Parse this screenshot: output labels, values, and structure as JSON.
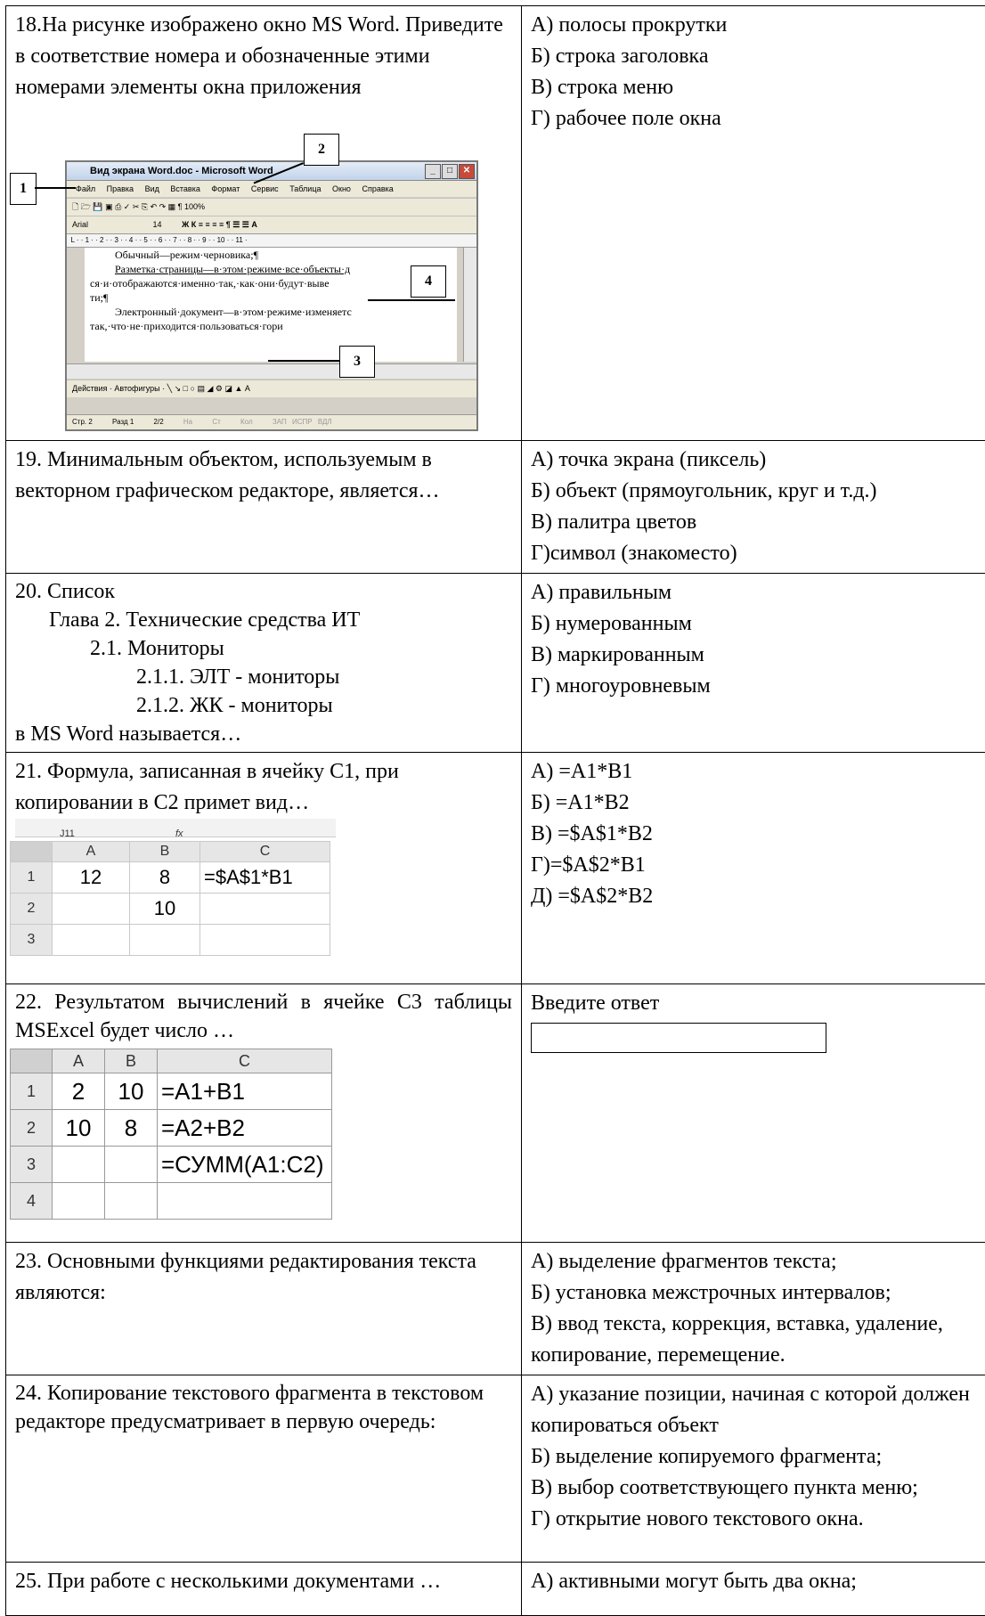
{
  "questions": [
    {
      "q": "18.На рисунке изображено окно  MS Word. Приведите в соответствие номера и обозначенные этими номерами элементы окна приложения",
      "options": [
        "А) полосы прокрутки",
        "Б) строка заголовка",
        "В) строка меню",
        "Г) рабочее поле окна"
      ],
      "figure": {
        "title": "Вид экрана Word.doc - Microsoft Word",
        "menu": [
          "Файл",
          "Правка",
          "Вид",
          "Вставка",
          "Формат",
          "Сервис",
          "Таблица",
          "Окно",
          "Справка"
        ],
        "toolbar1": "100%",
        "toolbar2_font": "Arial",
        "toolbar2_size": "14",
        "doc_lines": [
          "Обычный—режим·черновика;¶",
          "Разметка·страницы—в·этом·режиме·все·объекты·д",
          "ся·и·отображаются·именно·так,·как·они·будут·выве",
          "ти;¶",
          "Электронный·документ—в·этом·режиме·изменяетс",
          "так,·что·не·приходится·пользоваться·гори"
        ],
        "drawbar": "Действия · Автофигуры ·",
        "status": [
          "Стр. 2",
          "Разд 1",
          "2/2",
          "На",
          "Ст",
          "Кол",
          "ЗАП",
          "ИСПР",
          "ВДЛ"
        ],
        "callouts": [
          "1",
          "2",
          "3",
          "4"
        ]
      }
    },
    {
      "q": "19. Минимальным объектом, используемым в векторном графическом редакторе, является…",
      "options": [
        "А) точка экрана (пиксель)",
        "Б) объект (прямоугольник, круг и т.д.)",
        "В) палитра цветов",
        "Г)символ (знакоместо)"
      ]
    },
    {
      "q_lines": [
        "20. Список",
        "Глава 2. Технические средства ИТ",
        "2.1. Мониторы",
        "2.1.1. ЭЛТ - мониторы",
        "2.1.2. ЖК - мониторы",
        "в MS Word называется…"
      ],
      "options": [
        "А) правильным",
        "Б) нумерованным",
        "В) маркированным",
        "Г) многоуровневым"
      ]
    },
    {
      "q": "21. Формула, записанная в ячейку С1, при копировании в С2 примет вид…",
      "options": [
        "А) =A1*B1",
        "Б) =A1*B2",
        "В) =$A$1*B2",
        "Г)=$A$2*B1",
        "Д) =$A$2*B2"
      ],
      "sheet": {
        "namebox": "J11",
        "fx": "fx",
        "cols": [
          "A",
          "B",
          "C"
        ],
        "rows": [
          {
            "n": "1",
            "cells": [
              "12",
              "8",
              "=$A$1*B1"
            ]
          },
          {
            "n": "2",
            "cells": [
              "",
              "10",
              ""
            ]
          },
          {
            "n": "3",
            "cells": [
              "",
              "",
              ""
            ]
          }
        ]
      }
    },
    {
      "q": "22. Результатом вычислений в ячейке С3 таблицы MSExcel будет число …",
      "answer_label": "Введите ответ",
      "sheet": {
        "cols": [
          "A",
          "B",
          "C"
        ],
        "rows": [
          {
            "n": "1",
            "cells": [
              "2",
              "10",
              "=A1+B1"
            ]
          },
          {
            "n": "2",
            "cells": [
              "10",
              "8",
              "=A2+B2"
            ]
          },
          {
            "n": "3",
            "cells": [
              "",
              "",
              "=СУММ(A1:C2)"
            ]
          },
          {
            "n": "4",
            "cells": [
              "",
              "",
              ""
            ]
          }
        ]
      }
    },
    {
      "q": "23. Основными функциями редактирования текста являются:",
      "options": [
        "А) выделение фрагментов текста;",
        "Б) установка межстрочных интервалов;",
        "В) ввод текста, коррекция, вставка, удаление, копирование, перемещение."
      ]
    },
    {
      "q": "24. Копирование текстового фрагмента в текстовом редакторе предусматривает в первую очередь:",
      "options": [
        "А) указание позиции, начиная с которой должен копироваться объект",
        "Б) выделение копируемого фрагмента;",
        "В) выбор соответствующего пункта меню;",
        "Г) открытие нового текстового окна."
      ]
    },
    {
      "q": "25. При работе с несколькими документами …",
      "options": [
        "А) активными могут быть два окна;"
      ]
    }
  ]
}
